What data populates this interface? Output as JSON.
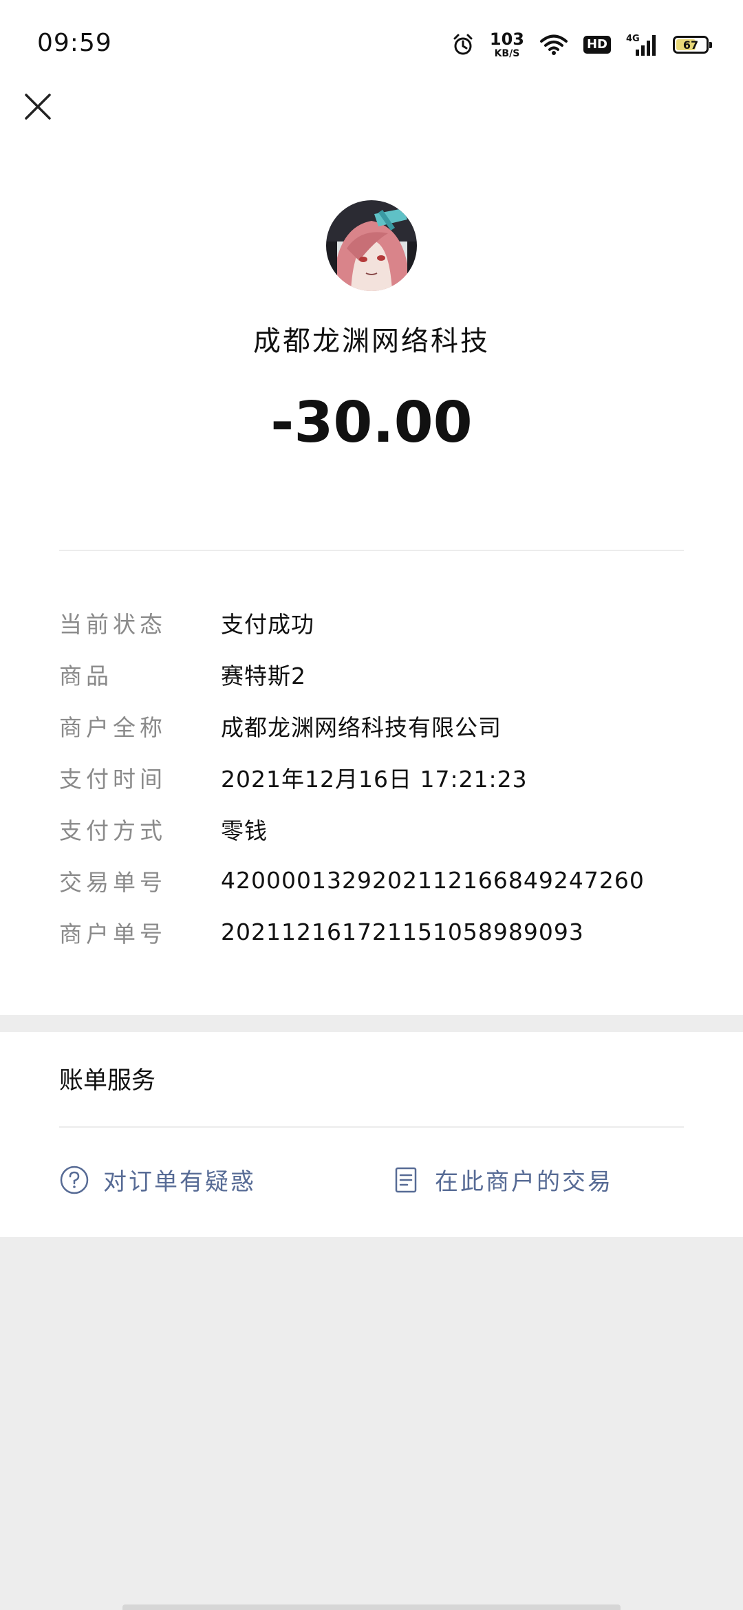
{
  "status_bar": {
    "time": "09:59",
    "net_speed": "103",
    "net_speed_unit": "KB/S",
    "hd_label": "HD",
    "network_type": "4G",
    "battery_level": "67",
    "icons": [
      "alarm-icon",
      "wifi-icon",
      "hd-icon",
      "signal-icon",
      "battery-icon"
    ]
  },
  "header": {
    "close_icon": "close-icon"
  },
  "merchant": {
    "name": "成都龙渊网络科技",
    "amount": "-30.00"
  },
  "details": [
    {
      "label": "当前状态",
      "value": "支付成功"
    },
    {
      "label": "商品",
      "value": "赛特斯2"
    },
    {
      "label": "商户全称",
      "value": "成都龙渊网络科技有限公司"
    },
    {
      "label": "支付时间",
      "value": "2021年12月16日 17:21:23"
    },
    {
      "label": "支付方式",
      "value": "零钱"
    },
    {
      "label": "交易单号",
      "value": "4200001329202112166849247260"
    },
    {
      "label": "商户单号",
      "value": "20211216172115105898909​3"
    }
  ],
  "services": {
    "title": "账单服务",
    "doubt_label": "对订单有疑惑",
    "merchant_tx_label": "在此商户的交易"
  },
  "colors": {
    "link": "#576b95",
    "label_gray": "#8a8a8a",
    "page_bg": "#ededed"
  }
}
